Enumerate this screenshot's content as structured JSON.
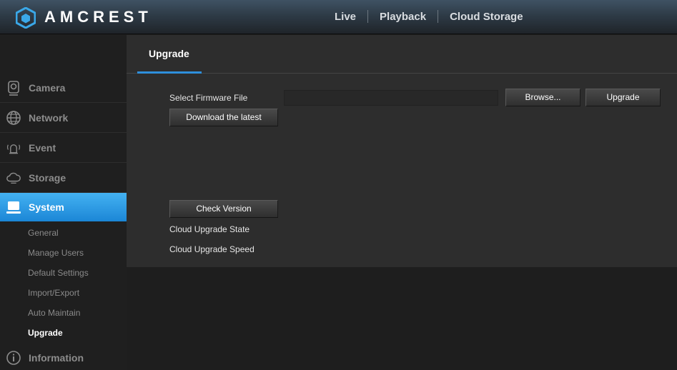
{
  "header": {
    "brand": "AMCREST",
    "nav": [
      "Live",
      "Playback",
      "Cloud Storage"
    ]
  },
  "sidebar": {
    "items": [
      {
        "label": "Camera",
        "icon": "camera-icon"
      },
      {
        "label": "Network",
        "icon": "globe-icon"
      },
      {
        "label": "Event",
        "icon": "alarm-icon"
      },
      {
        "label": "Storage",
        "icon": "cloud-icon"
      },
      {
        "label": "System",
        "icon": "monitor-icon",
        "active": true
      }
    ],
    "sub_items": [
      "General",
      "Manage Users",
      "Default Settings",
      "Import/Export",
      "Auto Maintain",
      "Upgrade"
    ],
    "current_sub": "Upgrade",
    "info": {
      "label": "Information",
      "icon": "info-icon"
    }
  },
  "main": {
    "tab": "Upgrade",
    "firmware_label": "Select Firmware File",
    "firmware_value": "",
    "browse_label": "Browse...",
    "upgrade_label": "Upgrade",
    "download_label": "Download the latest",
    "check_label": "Check Version",
    "cloud_state_label": "Cloud Upgrade State",
    "cloud_speed_label": "Cloud Upgrade Speed"
  },
  "colors": {
    "accent": "#2e8fdc",
    "active_gradient_top": "#44b2f2",
    "active_gradient_bottom": "#1b86d6"
  }
}
